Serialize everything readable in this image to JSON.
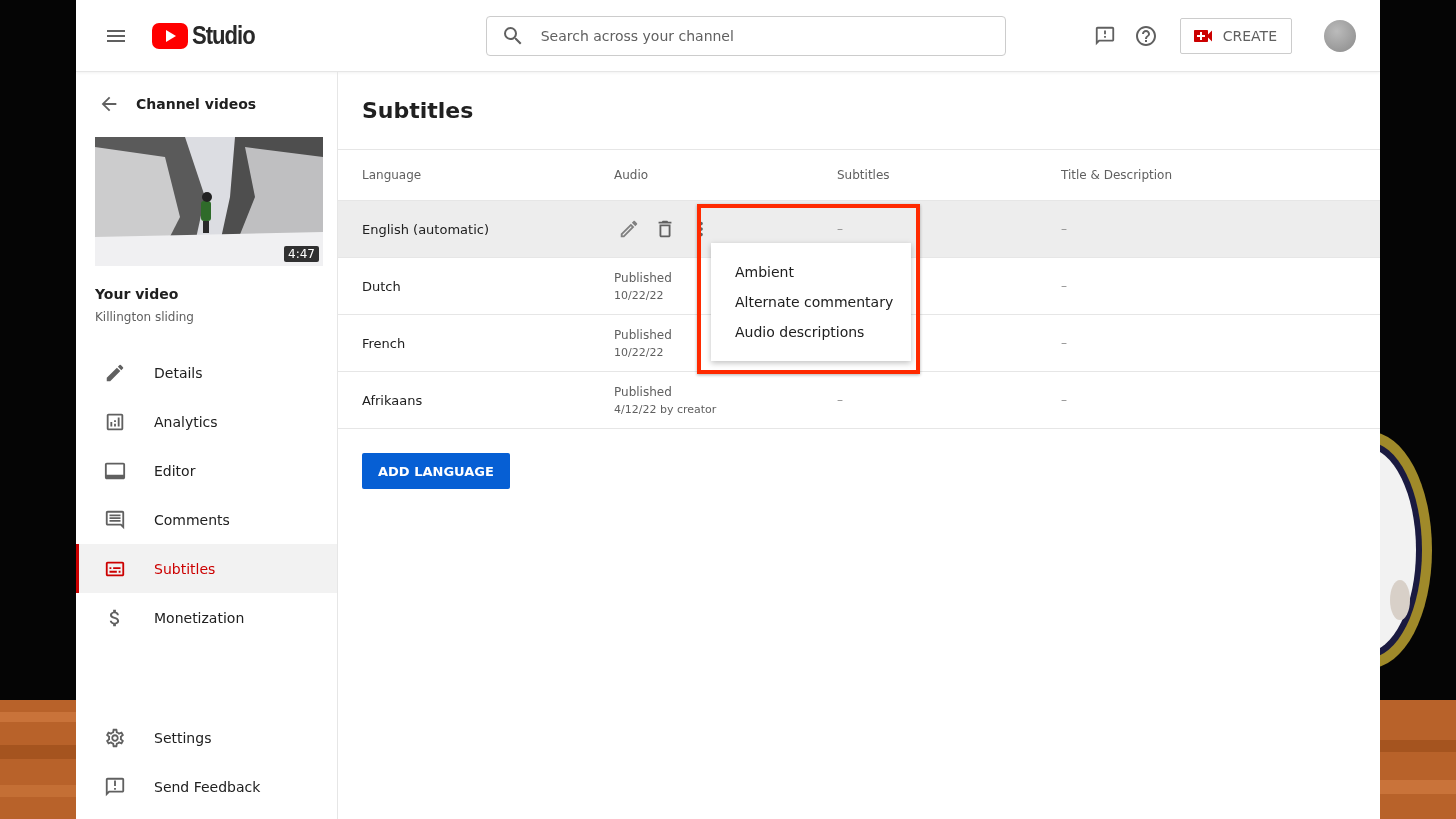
{
  "header": {
    "logo_text": "Studio",
    "search": {
      "placeholder": "Search across your channel"
    },
    "create_label": "CREATE"
  },
  "sidebar": {
    "back_label": "Channel videos",
    "video": {
      "duration": "4:47",
      "heading": "Your video",
      "title": "Killington sliding"
    },
    "items": [
      {
        "kind": "pencil",
        "label": "Details",
        "selected": false
      },
      {
        "kind": "chart",
        "label": "Analytics",
        "selected": false
      },
      {
        "kind": "film",
        "label": "Editor",
        "selected": false
      },
      {
        "kind": "comment",
        "label": "Comments",
        "selected": false
      },
      {
        "kind": "subtitles",
        "label": "Subtitles",
        "selected": true
      },
      {
        "kind": "dollar",
        "label": "Monetization",
        "selected": false
      }
    ],
    "footer_items": [
      {
        "kind": "gear",
        "label": "Settings"
      },
      {
        "kind": "feedback",
        "label": "Send Feedback"
      }
    ]
  },
  "page_title": "Subtitles",
  "table": {
    "columns": [
      "Language",
      "Audio",
      "Subtitles",
      "Title & Description"
    ],
    "rows": [
      {
        "language": "English (automatic)",
        "audio": {
          "kind": "actions"
        },
        "subtitles": "–",
        "title_description": "–",
        "highlighted": true
      },
      {
        "language": "Dutch",
        "audio": {
          "kind": "status",
          "status": "Published",
          "date": "10/22/22"
        },
        "title_description": "–",
        "highlighted": false
      },
      {
        "language": "French",
        "audio": {
          "kind": "status",
          "status": "Published",
          "date": "10/22/22"
        },
        "title_description": "–",
        "highlighted": false
      },
      {
        "language": "Afrikaans",
        "audio": {
          "kind": "status",
          "status": "Published",
          "date": "4/12/22 by creator"
        },
        "subtitles": "–",
        "title_description": "–",
        "highlighted": false
      }
    ]
  },
  "menu": {
    "items": [
      "Ambient",
      "Alternate commentary",
      "Audio descriptions"
    ]
  },
  "add_language_button": "ADD LANGUAGE"
}
